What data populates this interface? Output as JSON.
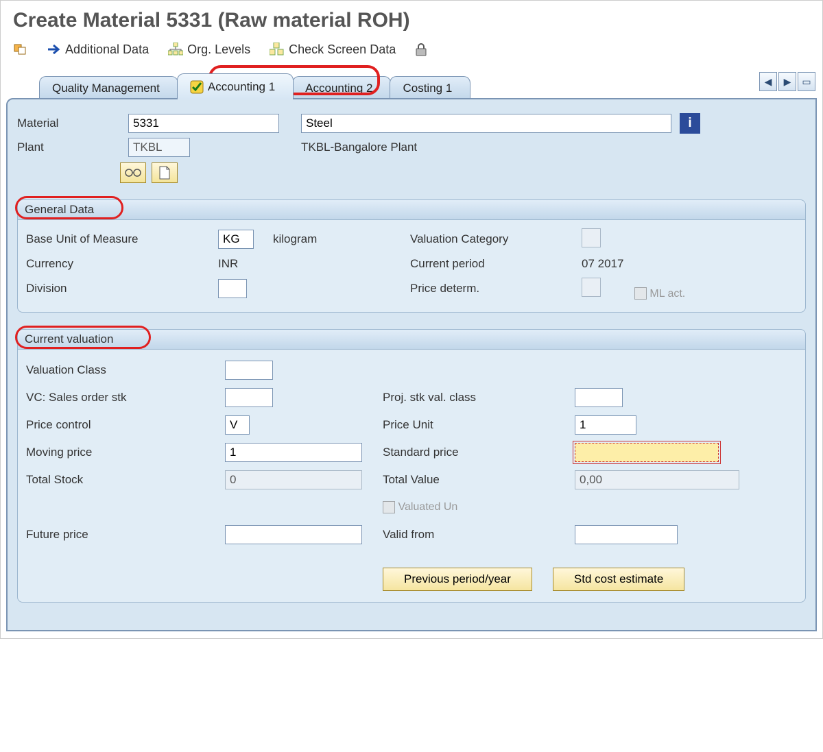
{
  "title": "Create Material 5331 (Raw material ROH)",
  "toolbar": {
    "additional_data": "Additional Data",
    "org_levels": "Org. Levels",
    "check_screen_data": "Check Screen Data"
  },
  "tabs": {
    "quality": "Quality Management",
    "acct1": "Accounting 1",
    "acct2": "Accounting 2",
    "cost1": "Costing 1"
  },
  "header": {
    "material_label": "Material",
    "material_value": "5331",
    "material_desc": "Steel",
    "plant_label": "Plant",
    "plant_value": "TKBL",
    "plant_desc": "TKBL-Bangalore Plant"
  },
  "general": {
    "title": "General Data",
    "labels": {
      "buom": "Base Unit of Measure",
      "uom_text": "kilogram",
      "val_cat": "Valuation Category",
      "currency": "Currency",
      "curr_period": "Current period",
      "division": "Division",
      "price_det": "Price determ.",
      "ml_act": "ML act."
    },
    "values": {
      "buom": "KG",
      "currency": "INR",
      "curr_period": "07 2017",
      "division": "",
      "val_cat": "",
      "price_det": ""
    }
  },
  "valuation": {
    "title": "Current valuation",
    "labels": {
      "val_class": "Valuation Class",
      "vc_sales": "VC: Sales order stk",
      "proj_stk": "Proj. stk val. class",
      "price_ctrl": "Price control",
      "price_unit": "Price Unit",
      "mov_price": "Moving price",
      "std_price": "Standard price",
      "tot_stock": "Total Stock",
      "tot_value": "Total Value",
      "valuated_un": "Valuated Un",
      "future_price": "Future price",
      "valid_from": "Valid from"
    },
    "values": {
      "val_class": "",
      "vc_sales": "",
      "proj_stk": "",
      "price_ctrl": "V",
      "price_unit": "1",
      "mov_price": "1",
      "std_price": "",
      "tot_stock": "0",
      "tot_value": "0,00",
      "future_price": "",
      "valid_from": ""
    },
    "buttons": {
      "prev_period": "Previous period/year",
      "std_cost": "Std cost estimate"
    }
  }
}
